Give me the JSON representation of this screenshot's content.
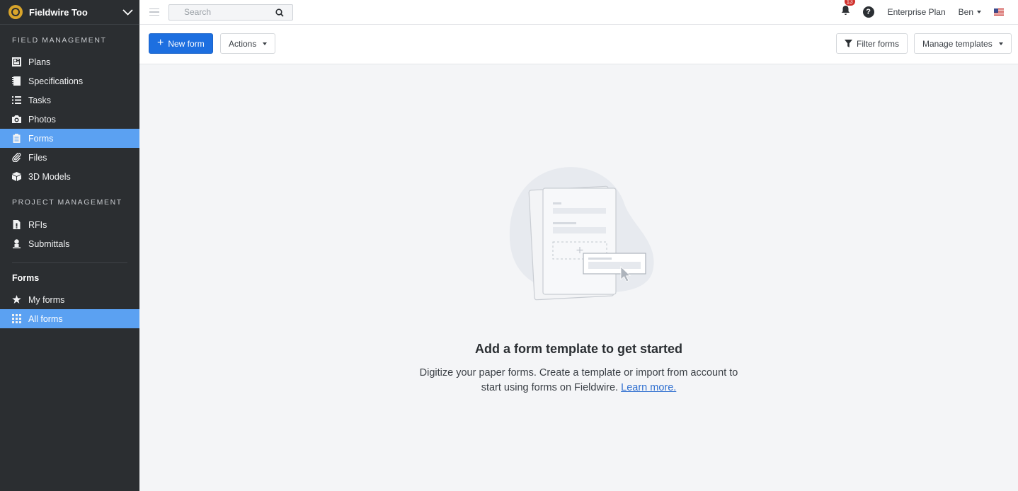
{
  "project": {
    "name": "Fieldwire Too"
  },
  "sidebar": {
    "field_management_title": "FIELD MANAGEMENT",
    "field_items": [
      {
        "label": "Plans",
        "icon": "plans-icon"
      },
      {
        "label": "Specifications",
        "icon": "specifications-icon"
      },
      {
        "label": "Tasks",
        "icon": "tasks-icon"
      },
      {
        "label": "Photos",
        "icon": "camera-icon"
      },
      {
        "label": "Forms",
        "icon": "clipboard-icon",
        "active": true
      },
      {
        "label": "Files",
        "icon": "paperclip-icon"
      },
      {
        "label": "3D Models",
        "icon": "cube-icon"
      }
    ],
    "project_management_title": "PROJECT MANAGEMENT",
    "project_items": [
      {
        "label": "RFIs",
        "icon": "rfi-icon"
      },
      {
        "label": "Submittals",
        "icon": "submittals-icon"
      }
    ],
    "forms_title": "Forms",
    "forms_items": [
      {
        "label": "My forms",
        "icon": "star-icon"
      },
      {
        "label": "All forms",
        "icon": "grid-icon",
        "active": true
      }
    ]
  },
  "topbar": {
    "search_placeholder": "Search",
    "notification_count": "13",
    "help_symbol": "?",
    "plan": "Enterprise Plan",
    "user": "Ben"
  },
  "toolbar": {
    "new_form_label": "New form",
    "actions_label": "Actions",
    "filter_label": "Filter forms",
    "manage_templates_label": "Manage templates"
  },
  "empty_state": {
    "title": "Add a form template to get started",
    "description": "Digitize your paper forms. Create a template or import from account to start using forms on Fieldwire.",
    "link": "Learn more."
  },
  "colors": {
    "sidebar_bg": "#2b2e31",
    "active_item": "#5ba1f2",
    "primary_button": "#1d6fe0",
    "badge": "#d0312d"
  }
}
